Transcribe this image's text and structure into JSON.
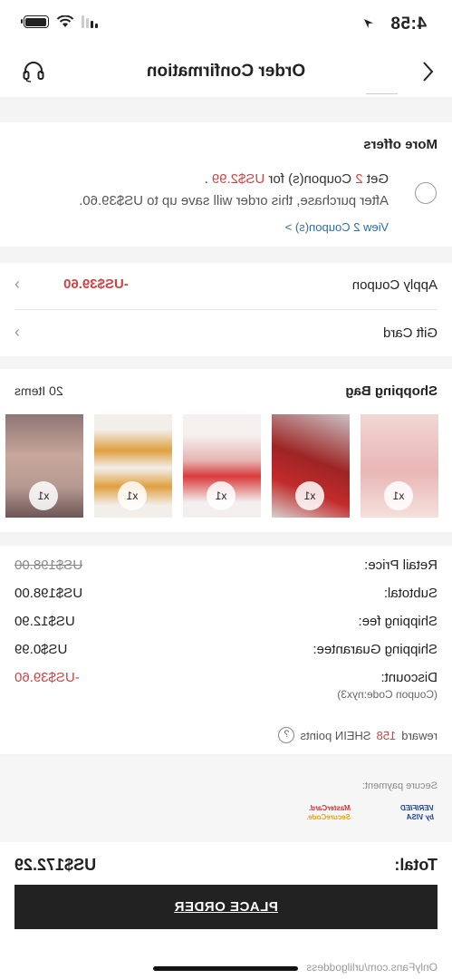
{
  "status_bar": {
    "time": "4:58"
  },
  "navbar": {
    "title": "Order Confirmation"
  },
  "offers": {
    "title": "More offers",
    "line1_prefix": "Get",
    "coupon_count": "2",
    "line1_mid": "Coupon(s) for",
    "coupon_price": "US$2.99",
    "line1_end": ".",
    "line2": "After purchase, this order will save up to US$39.60.",
    "view_link": "View 2 Coupon(s) >"
  },
  "apply_coupon": {
    "label": "Apply Coupon",
    "value": "-US$39.60"
  },
  "gift_card": {
    "label": "Gift Card"
  },
  "bag": {
    "title": "Shopping Bag",
    "count": "20 Items",
    "items": [
      {
        "qty": "x1"
      },
      {
        "qty": "x1"
      },
      {
        "qty": "x1"
      },
      {
        "qty": "x1"
      },
      {
        "qty": "x1"
      }
    ]
  },
  "summary": {
    "retail_label": "Retail Price:",
    "retail_value": "US$198.00",
    "subtotal_label": "Subtotal:",
    "subtotal_value": "US$198.00",
    "shipping_label": "Shipping fee:",
    "shipping_value": "US$12.90",
    "guarantee_label": "Shipping Guarantee:",
    "guarantee_value": "US$0.99",
    "discount_label": "Discount:",
    "discount_value": "-US$39.60",
    "coupon_code": "(Coupon Code:nyx3)"
  },
  "reward": {
    "prefix": "reward",
    "points": "158",
    "suffix": "SHEIN points",
    "help": "?"
  },
  "secure": {
    "label": "Secure payment:",
    "visa_line1": "VERIFIED",
    "visa_line2": "by VISA",
    "mc_line1": "MasterCard.",
    "mc_line2": "SecureCode."
  },
  "total": {
    "label": "Total:",
    "value": "US$172.29"
  },
  "place_order": "PLACE ORDER",
  "watermark": "OnlyFans.com/urlilgoddess",
  "colors": {
    "accent_red": "#c44444",
    "link_blue": "#2b6ea7",
    "button_black": "#222222"
  }
}
